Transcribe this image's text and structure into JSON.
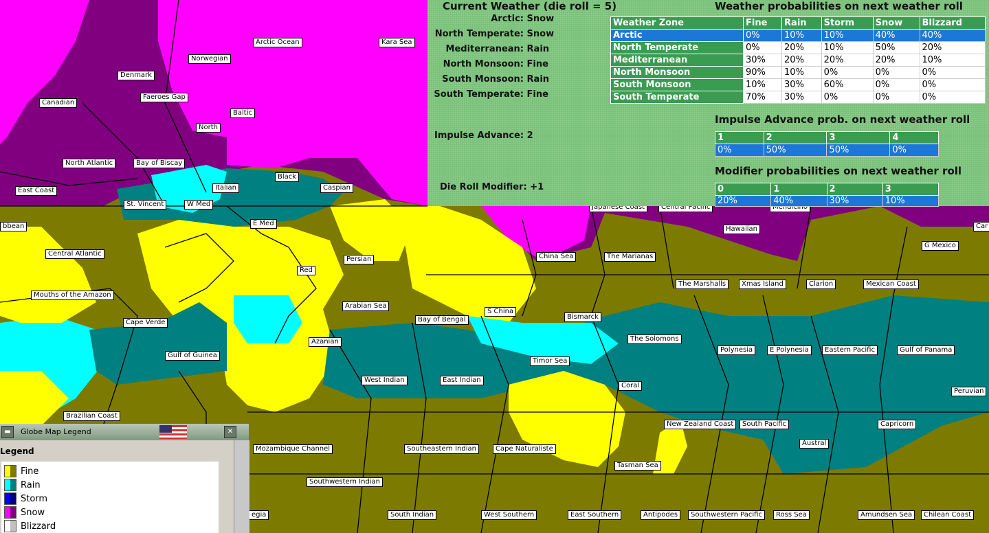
{
  "colors": {
    "fine_light": "#ffff00",
    "fine_dark": "#7d7a00",
    "rain_light": "#00ffff",
    "rain_dark": "#008080",
    "storm_light": "#0000ff",
    "storm_dark": "#000080",
    "snow_light": "#ff00ff",
    "snow_dark": "#800080",
    "blizzard_light": "#ffffff",
    "blizzard_dark": "#c0c0c0"
  },
  "current_weather": {
    "title": "Current Weather (die roll = 5)",
    "rows": [
      {
        "zone": "Arctic:",
        "value": "Snow"
      },
      {
        "zone": "North Temperate:",
        "value": "Snow"
      },
      {
        "zone": "Mediterranean:",
        "value": "Rain"
      },
      {
        "zone": "North Monsoon:",
        "value": "Fine"
      },
      {
        "zone": "South Monsoon:",
        "value": "Rain"
      },
      {
        "zone": "South Temperate:",
        "value": "Fine"
      }
    ],
    "impulse_label": "Impulse Advance:",
    "impulse_value": "2",
    "modifier_label": "Die Roll Modifier:",
    "modifier_value": "+1"
  },
  "probabilities": {
    "title": "Weather probabilities on next weather roll",
    "headers": [
      "Weather Zone",
      "Fine",
      "Rain",
      "Storm",
      "Snow",
      "Blizzard"
    ],
    "rows": [
      [
        "Arctic",
        "0%",
        "10%",
        "10%",
        "40%",
        "40%"
      ],
      [
        "North Temperate",
        "0%",
        "20%",
        "10%",
        "50%",
        "20%"
      ],
      [
        "Mediterranean",
        "30%",
        "20%",
        "20%",
        "20%",
        "10%"
      ],
      [
        "North Monsoon",
        "90%",
        "10%",
        "0%",
        "0%",
        "0%"
      ],
      [
        "South Monsoon",
        "10%",
        "30%",
        "60%",
        "0%",
        "0%"
      ],
      [
        "South Temperate",
        "70%",
        "30%",
        "0%",
        "0%",
        "0%"
      ]
    ]
  },
  "impulse_prob": {
    "title": "Impulse Advance prob. on next weather roll",
    "headers": [
      "1",
      "2",
      "3",
      "4"
    ],
    "values": [
      "0%",
      "50%",
      "50%",
      "0%"
    ]
  },
  "modifier_prob": {
    "title": "Modifier probabilities on next weather roll",
    "headers": [
      "0",
      "1",
      "2",
      "3"
    ],
    "values": [
      "20%",
      "40%",
      "30%",
      "10%"
    ]
  },
  "legend": {
    "window_title": "Globe Map Legend",
    "header": "Legend",
    "items": [
      {
        "label": "Fine"
      },
      {
        "label": "Rain"
      },
      {
        "label": "Storm"
      },
      {
        "label": "Snow"
      },
      {
        "label": "Blizzard"
      }
    ]
  },
  "sea_areas": [
    "Arctic Ocean",
    "Kara Sea",
    "Norwegian",
    "Denmark",
    "Canadian",
    "Faeroes Gap",
    "Baltic",
    "North",
    "North Atlantic",
    "Bay of Biscay",
    "East Coast",
    "Black",
    "Caspian",
    "Italian",
    "St. Vincent",
    "W Med",
    "E Med",
    "bbean",
    "Central Atlantic",
    "Persian",
    "Red",
    "Mouths of the Amazon",
    "Arabian Sea",
    "Cape Verde",
    "Azanian",
    "Gulf of Guinea",
    "West Indian",
    "East Indian",
    "Bay of Bengal",
    "S China",
    "China Sea",
    "The Marianas",
    "Japanese Coast",
    "Central Pacific",
    "Hawaiian",
    "Mendicino",
    "Car",
    "G Mexico",
    "The Marshalls",
    "Xmas Island",
    "Clarion",
    "Mexican Coast",
    "Bismarck",
    "The Solomons",
    "Timor Sea",
    "Polynesia",
    "E Polynesia",
    "Eastern Pacific",
    "Gulf of Panama",
    "Coral",
    "Peruvian",
    "Brazilian Coast",
    "New Zealand Coast",
    "South Pacific",
    "Capricorn",
    "Austral",
    "Mozambique Channel",
    "Southeastern Indian",
    "Cape Naturaliste",
    "Tasman Sea",
    "Southwestern Indian",
    "South Indian",
    "West Southern",
    "East Southern",
    "Antipodes",
    "Southwestern Pacific",
    "Ross Sea",
    "Amundsen Sea",
    "Chilean Coast",
    "egia"
  ]
}
